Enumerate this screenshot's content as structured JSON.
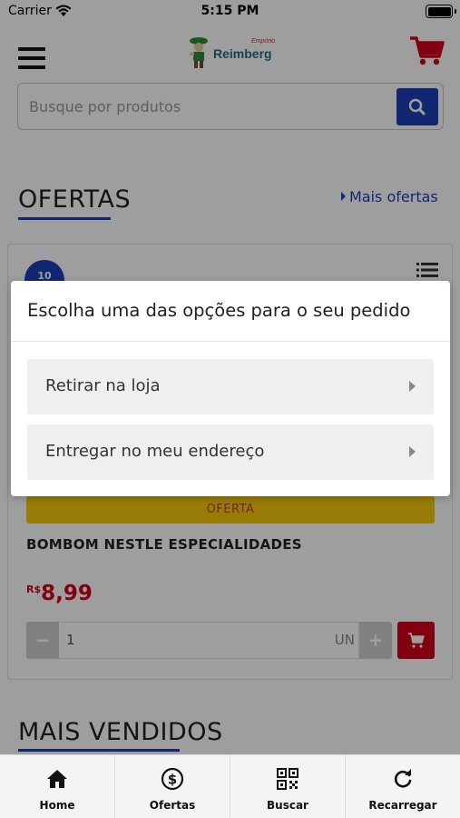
{
  "status_bar": {
    "carrier": "Carrier",
    "time": "5:15 PM"
  },
  "header": {
    "logo_text": "Reimberg",
    "logo_subtext": "Empório"
  },
  "search": {
    "placeholder": "Busque por produtos"
  },
  "offers_section": {
    "title": "OFERTAS",
    "more_link": "Mais ofertas"
  },
  "product": {
    "badge": "10",
    "offer_label": "OFERTA",
    "name": "BOMBOM NESTLE ESPECIALIDADES",
    "currency": "R$",
    "price": "8,99",
    "quantity": "1",
    "unit": "UN"
  },
  "best_sellers_section": {
    "title": "MAIS VENDIDOS"
  },
  "modal": {
    "title": "Escolha uma das opções para o seu pedido",
    "options": [
      {
        "label": "Retirar na loja"
      },
      {
        "label": "Entregar no meu endereço"
      }
    ]
  },
  "tabbar": {
    "items": [
      {
        "label": "Home",
        "icon": "home-icon"
      },
      {
        "label": "Ofertas",
        "icon": "dollar-icon"
      },
      {
        "label": "Buscar",
        "icon": "qr-code-icon"
      },
      {
        "label": "Recarregar",
        "icon": "reload-icon"
      }
    ]
  },
  "colors": {
    "primary_blue": "#1e3fb8",
    "price_red": "#d0021b",
    "offer_yellow": "#f6c90e",
    "cart_red": "#d0021b"
  }
}
